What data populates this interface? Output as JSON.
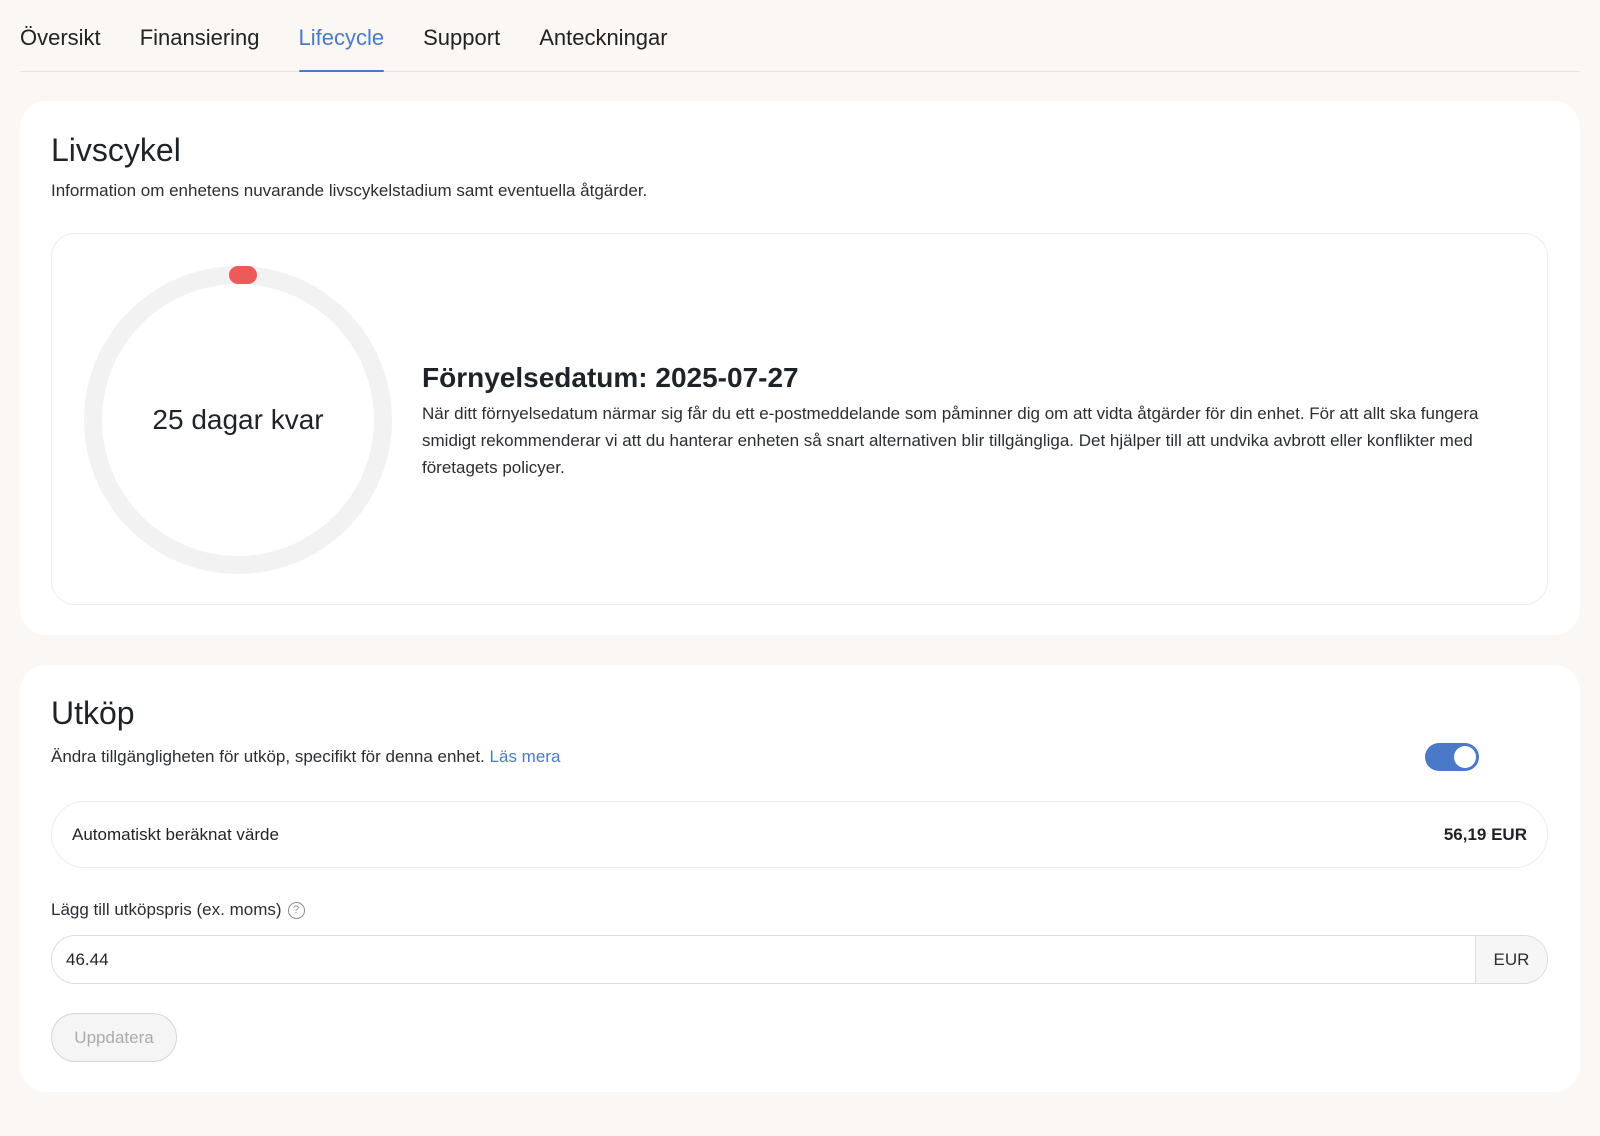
{
  "tabs": [
    {
      "label": "Översikt"
    },
    {
      "label": "Finansiering"
    },
    {
      "label": "Lifecycle"
    },
    {
      "label": "Support"
    },
    {
      "label": "Anteckningar"
    }
  ],
  "active_tab": "Lifecycle",
  "lifecycle": {
    "title": "Livscykel",
    "subtitle": "Information om enhetens nuvarande livscykelstadium samt eventuella åtgärder.",
    "countdown_label": "25 dagar kvar",
    "renewal_title": "Förnyelsedatum: 2025-07-27",
    "renewal_text": "När ditt förnyelsedatum närmar sig får du ett e-postmeddelande som påminner dig om att vidta åtgärder för din enhet. För att allt ska fungera smidigt rekommenderar vi att du hanterar enheten så snart alternativen blir tillgängliga. Det hjälper till att undvika avbrott eller konflikter med företagets policyer.",
    "ring_progress_color": "#ec5a5a",
    "ring_track_color": "#f2f2f2"
  },
  "buyout": {
    "title": "Utköp",
    "description": "Ändra tillgängligheten för utköp, specifikt för denna enhet.",
    "read_more": "Läs mera",
    "toggle_on": true,
    "auto_value_label": "Automatiskt beräknat värde",
    "auto_value_amount": "56,19 EUR",
    "price_label": "Lägg till utköpspris (ex. moms)",
    "help_icon": "question-circle-icon",
    "price_value": "46.44",
    "currency": "EUR",
    "update_label": "Uppdatera"
  },
  "colors": {
    "accent": "#4a7ac7",
    "page_bg": "#faf7f4"
  }
}
